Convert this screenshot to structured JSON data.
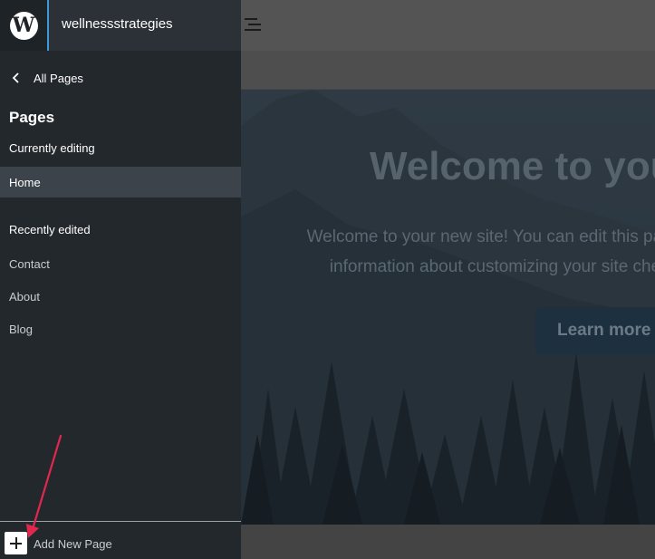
{
  "header": {
    "site_name": "wellnessstrategies",
    "logo_icon": "wordpress-logo-icon",
    "toolbar_icon": "list-view-icon"
  },
  "sidebar": {
    "back_label": "All Pages",
    "back_icon": "chevron-left-icon",
    "title": "Pages",
    "currently_editing_label": "Currently editing",
    "current_page": "Home",
    "recently_edited_label": "Recently edited",
    "recent_pages": [
      "Contact",
      "About",
      "Blog"
    ],
    "add_new_label": "Add New Page",
    "add_new_icon": "plus-icon"
  },
  "canvas": {
    "hero_title": "Welcome to you",
    "hero_text_line1": "Welcome to your new site! You can edit this page to",
    "hero_text_line2": "information about customizing your site check",
    "hero_button": "Learn more"
  },
  "annotation": {
    "color": "#e0284f",
    "icon": "annotation-arrow-icon"
  },
  "colors": {
    "sidebar_bg": "#23282d",
    "active_item_bg": "#3d434a",
    "accent": "#3a9bd6"
  }
}
